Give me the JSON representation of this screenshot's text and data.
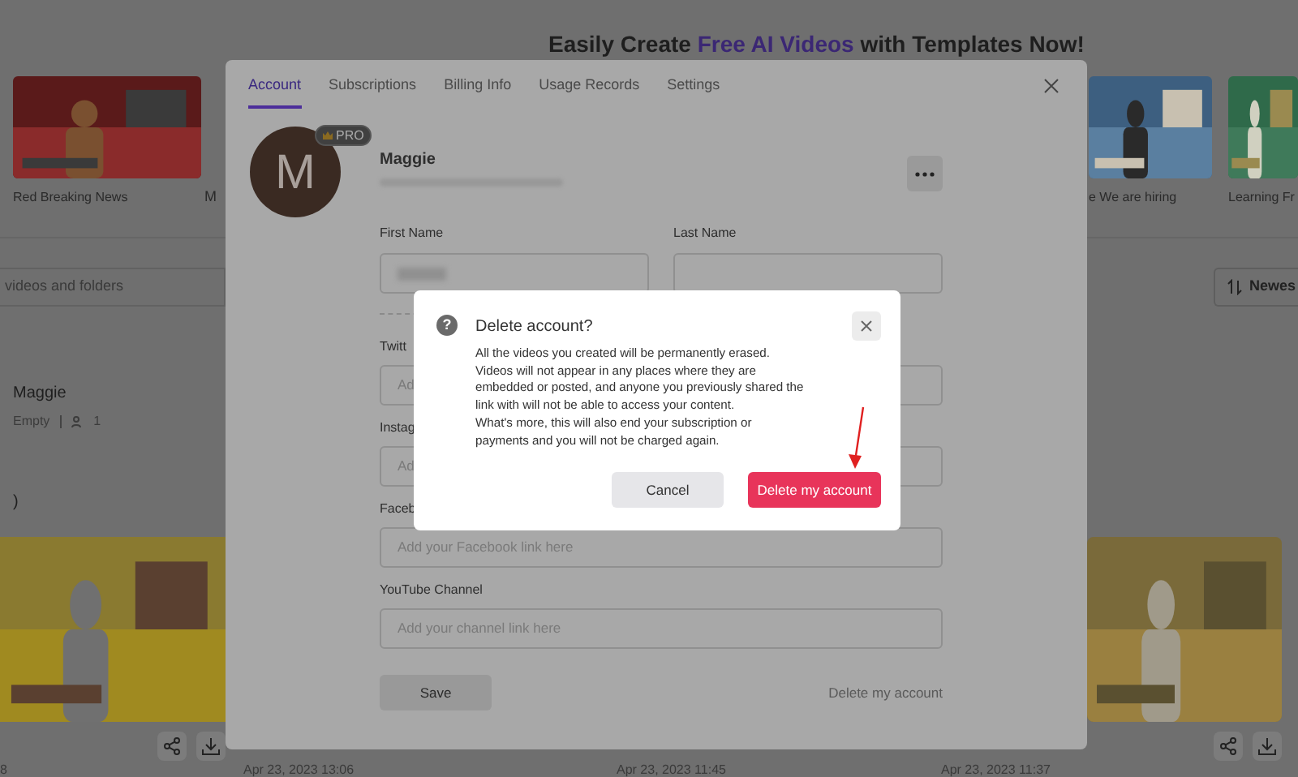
{
  "page": {
    "heading": {
      "before": "Easily Create ",
      "highlight": "Free AI Videos",
      "after": " with Templates Now!"
    },
    "templates": [
      {
        "title": "Red Breaking News",
        "kind": "picture"
      },
      {
        "title": "M",
        "kind": "label"
      },
      {
        "title": "e We are hiring",
        "kind": "picture"
      },
      {
        "title": "Learning Fr",
        "kind": "picture"
      }
    ],
    "search": {
      "placeholder": "videos and folders"
    },
    "sort": {
      "label": "Newes"
    },
    "folder": {
      "name": "Maggie",
      "status": "Empty",
      "members": "1"
    },
    "section_mark": ")",
    "videos": [
      {
        "kind": "picture"
      },
      {
        "kind": "picture"
      }
    ],
    "dates": [
      "8",
      "Apr 23, 2023 13:06",
      "Apr 23, 2023 11:45",
      "Apr 23, 2023 11:37"
    ]
  },
  "account_modal": {
    "tabs": [
      {
        "label": "Account",
        "selected": true
      },
      {
        "label": "Subscriptions",
        "selected": false
      },
      {
        "label": "Billing Info",
        "selected": false
      },
      {
        "label": "Usage Records",
        "selected": false
      },
      {
        "label": "Settings",
        "selected": false
      }
    ],
    "avatar_letter": "M",
    "badge": "PRO",
    "name": "Maggie",
    "fields": [
      {
        "label": "First Name",
        "blurred": true
      },
      {
        "label": "Last Name",
        "blurred": false
      }
    ],
    "links": [
      {
        "label": "Twitt",
        "placeholder": "Ad"
      },
      {
        "label": "Instag",
        "placeholder": "Ad"
      },
      {
        "label": "Faceb",
        "placeholder": "Add your Facebook link here"
      },
      {
        "label": "YouTube Channel",
        "placeholder": "Add your channel link here"
      }
    ],
    "save": "Save",
    "delete_link": "Delete my account"
  },
  "dialog": {
    "title": "Delete account?",
    "icon": "?",
    "lines": [
      "All the videos you created will be permanently erased.",
      "Videos will not appear in any places where they are",
      "embedded or posted, and anyone you previously shared the",
      "link with will not be able to access your content.",
      "What's more, this will also end your subscription or",
      "payments and you will not be charged again."
    ],
    "buttons": [
      {
        "label": "Cancel",
        "kind": "secondary"
      },
      {
        "label": "Delete my account",
        "kind": "danger"
      }
    ]
  }
}
